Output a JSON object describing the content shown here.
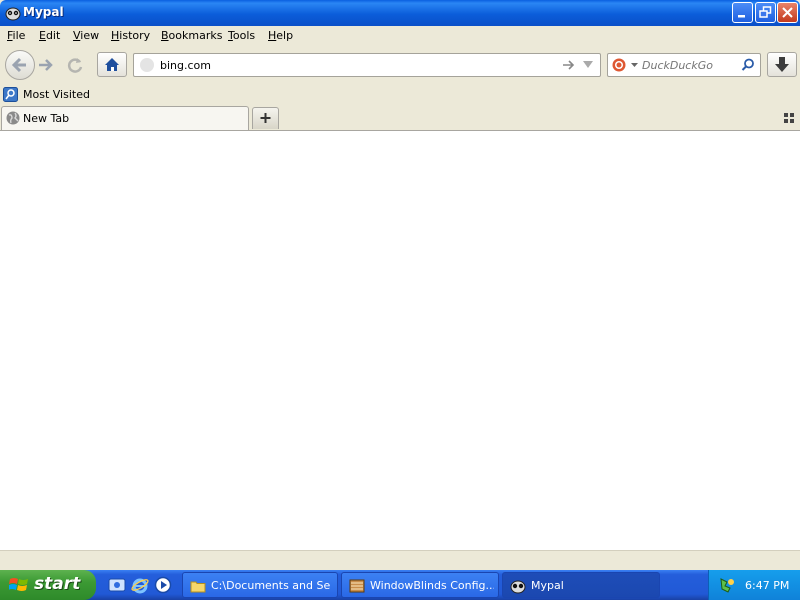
{
  "window": {
    "title": "Mypal",
    "controls": [
      "minimize",
      "restore",
      "close"
    ]
  },
  "menubar": {
    "items": [
      {
        "label": "File",
        "accel": "F",
        "rest": "ile"
      },
      {
        "label": "Edit",
        "accel": "E",
        "rest": "dit"
      },
      {
        "label": "View",
        "accel": "V",
        "rest": "iew"
      },
      {
        "label": "History",
        "accel": "H",
        "rest": "istory"
      },
      {
        "label": "Bookmarks",
        "accel": "B",
        "rest": "ookmarks"
      },
      {
        "label": "Tools",
        "accel": "T",
        "rest": "ools"
      },
      {
        "label": "Help",
        "accel": "H",
        "rest": "elp"
      }
    ]
  },
  "navbar": {
    "url_value": "bing.com",
    "search_placeholder": "DuckDuckGo",
    "icons": [
      "back-icon",
      "forward-icon",
      "reload-icon",
      "home-icon",
      "go-arrow-icon",
      "dropdown-icon",
      "duckduckgo-icon",
      "search-icon",
      "download-icon"
    ]
  },
  "bookmarks": {
    "items": [
      {
        "label": "Most Visited",
        "icon": "most-visited-icon"
      }
    ]
  },
  "tabs": {
    "items": [
      {
        "label": "New Tab",
        "icon": "globe-icon"
      }
    ],
    "new_tab_icon": "plus-icon"
  },
  "taskbar": {
    "start_label": "start",
    "quick_launch": [
      "show-desktop-icon",
      "internet-explorer-icon",
      "media-player-icon"
    ],
    "tasks": [
      {
        "label": "C:\\Documents and Se...",
        "icon": "folder-icon",
        "active": false
      },
      {
        "label": "WindowBlinds Config...",
        "icon": "windowblinds-icon",
        "active": false
      },
      {
        "label": "Mypal",
        "icon": "mypal-icon",
        "active": true
      }
    ],
    "clock": "6:47 PM"
  },
  "colors": {
    "titlebar": "#0A5FE0",
    "chrome": "#ECE9D8",
    "taskbar": "#245EDB",
    "start": "#3C9A34",
    "tray": "#0F82D9"
  }
}
